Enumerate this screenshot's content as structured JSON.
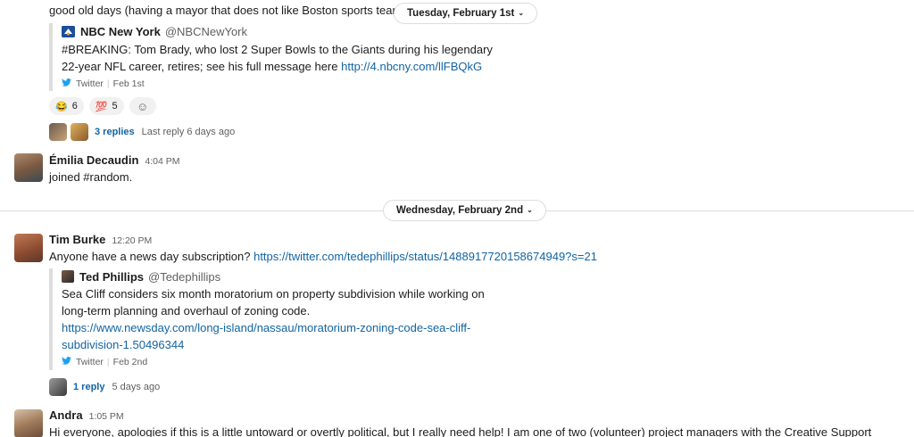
{
  "top_message": {
    "text": "good old days (having a mayor that does not like Boston sports teams"
  },
  "date_dividers": [
    {
      "label": "Tuesday, February 1st"
    },
    {
      "label": "Wednesday, February 2nd"
    }
  ],
  "nbc_attachment": {
    "name": "NBC New York",
    "handle": "@NBCNewYork",
    "body_line1": "#BREAKING: Tom Brady, who lost 2 Super Bowls to the Giants during his legendary",
    "body_line2": "22-year NFL career, retires; see his full message here ",
    "link": "http://4.nbcny.com/llFBQkG",
    "source": "Twitter",
    "date": "Feb 1st"
  },
  "reactions": [
    {
      "emoji": "😂",
      "count": "6"
    },
    {
      "emoji": "💯",
      "count": "5"
    }
  ],
  "add_reaction_icon": "☺",
  "thread1": {
    "replies": "3 replies",
    "meta": "Last reply 6 days ago"
  },
  "emilia": {
    "name": "Émilia Decaudin",
    "time": "4:04 PM",
    "text": "joined #random."
  },
  "tim": {
    "name": "Tim Burke",
    "time": "12:20 PM",
    "text": "Anyone have a news day subscription? ",
    "link": "https://twitter.com/tedephillips/status/1488917720158674949?s=21"
  },
  "ted_attachment": {
    "name": "Ted Phillips",
    "handle": "@Tedephillips",
    "line1": "Sea Cliff considers six month moratorium on property subdivision while working on",
    "line2": "long-term planning and overhaul of zoning code.",
    "link1": "https://www.newsday.com/long-island/nassau/moratorium-zoning-code-sea-cliff-",
    "link2": "subdivision-1.50496344",
    "source": "Twitter",
    "date": "Feb 2nd"
  },
  "thread2": {
    "replies": "1 reply",
    "meta": "5 days ago"
  },
  "andra": {
    "name": "Andra",
    "time": "1:05 PM",
    "text": "Hi everyone, apologies if this is a little untoward or overtly political, but I really need help! I am one of two (volunteer) project managers with the Creative Support"
  },
  "colors": {
    "link": "#1264a3",
    "twitter": "#1da1f2",
    "nbc": "#1c4e9c"
  }
}
